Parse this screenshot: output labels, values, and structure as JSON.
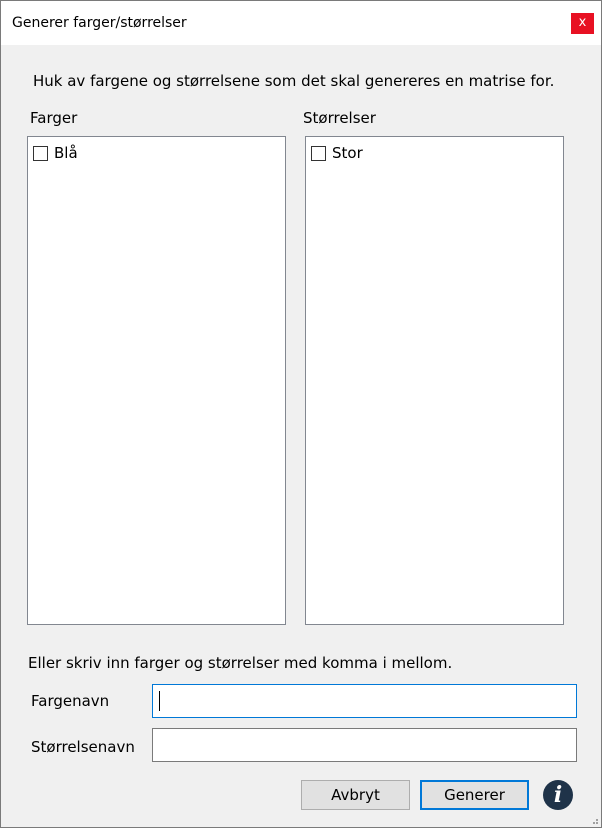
{
  "window": {
    "title": "Generer farger/størrelser",
    "close_label": "x"
  },
  "instruction": "Huk av fargene og størrelsene som det skal genereres en matrise for.",
  "colors_list": {
    "label": "Farger",
    "items": [
      {
        "label": "Blå",
        "checked": false
      }
    ]
  },
  "sizes_list": {
    "label": "Størrelser",
    "items": [
      {
        "label": "Stor",
        "checked": false
      }
    ]
  },
  "hint": "Eller skriv inn farger og størrelser med komma i mellom.",
  "color_name": {
    "label": "Fargenavn",
    "value": ""
  },
  "size_name": {
    "label": "Størrelsenavn",
    "value": ""
  },
  "buttons": {
    "cancel": "Avbryt",
    "generate": "Generer"
  },
  "icons": {
    "info": "info-icon",
    "close": "close-icon",
    "resize": "resize-grip-icon"
  },
  "colors": {
    "accent": "#0078d7",
    "close_button": "#e81123",
    "info_icon": "#1f3349",
    "dialog_background": "#f0f0f0"
  }
}
